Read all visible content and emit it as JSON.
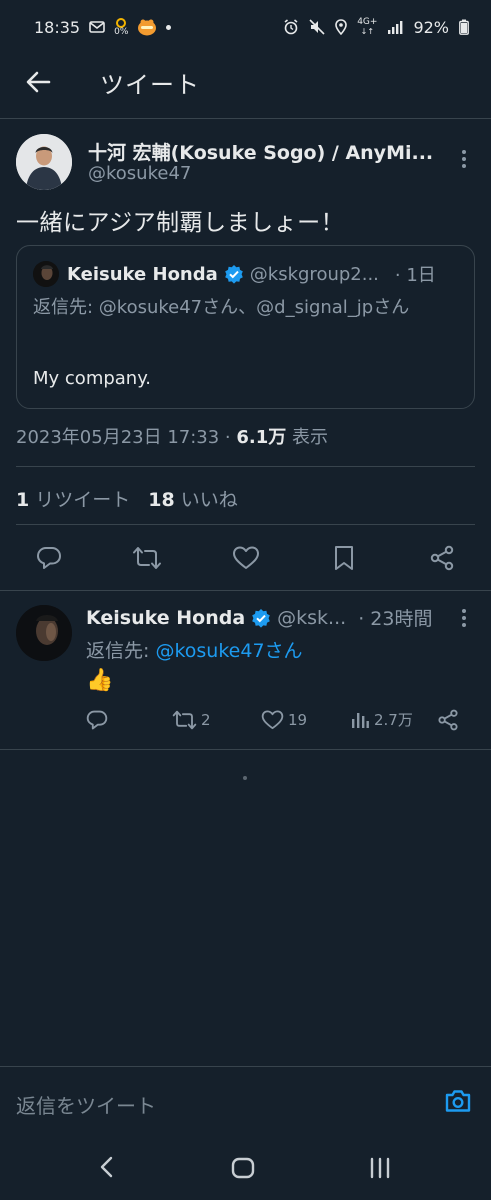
{
  "status_bar": {
    "time": "18:35",
    "icons_left": [
      "mail-notification-icon",
      "data-saver-icon",
      "app-notification-icon",
      "dot-icon"
    ],
    "data_saver_value": "0%",
    "network": "4G+",
    "battery": "92%"
  },
  "header": {
    "title": "ツイート"
  },
  "tweet": {
    "author_name": "十河 宏輔(Kosuke Sogo) / AnyMi...",
    "author_handle": "@kosuke47",
    "text": "一緒にアジア制覇しましょー！",
    "quote": {
      "author_name": "Keisuke Honda",
      "author_handle": "@kskgroup2...",
      "time": "· 1日",
      "reply_prefix": "返信先: ",
      "reply_to": "@kosuke47さん、@d_signal_jpさん",
      "text": "My company."
    },
    "timestamp": "2023年05月23日 17:33 · ",
    "views_count": "6.1万",
    "views_label": " 表示",
    "retweets_count": "1",
    "retweets_label": " リツイート",
    "likes_count": "18",
    "likes_label": " いいね"
  },
  "reply": {
    "author_name": "Keisuke Honda",
    "author_handle": "@ksk...",
    "time": "· 23時間",
    "reply_prefix": "返信先: ",
    "reply_to": "@kosuke47さん",
    "emoji": "👍",
    "retweets": "2",
    "likes": "19",
    "views": "2.7万"
  },
  "composer": {
    "placeholder": "返信をツイート"
  },
  "colors": {
    "background": "#15202b",
    "accent": "#1d9bf0",
    "verified": "#1d9bf0",
    "muted_text": "#8b98a5",
    "border": "#38444d"
  }
}
